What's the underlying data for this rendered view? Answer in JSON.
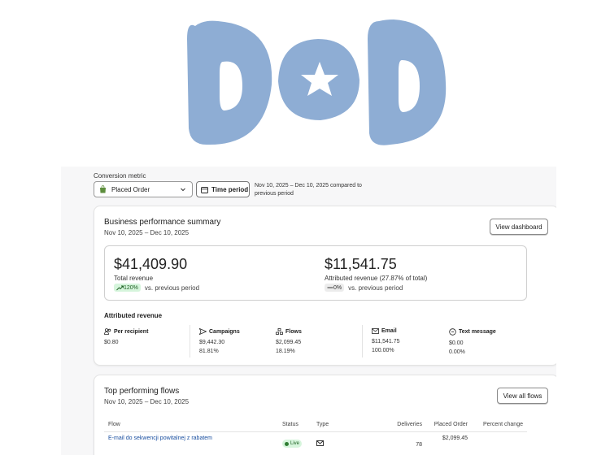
{
  "conversion": {
    "label": "Conversion metric",
    "selected": "Placed Order",
    "time_period_label": "Time period",
    "period_text": "Nov 10, 2025 – Dec 10, 2025 compared to previous period"
  },
  "summary": {
    "title": "Business performance summary",
    "date_range": "Nov 10, 2025 – Dec 10, 2025",
    "view_button": "View dashboard",
    "total_revenue": "$41,409.90",
    "total_label": "Total revenue",
    "total_delta": "120%",
    "total_delta_text": "vs. previous period",
    "attributed_revenue": "$11,541.75",
    "attributed_label": "Attributed revenue (27.87% of total)",
    "attributed_delta": "0%",
    "attributed_delta_text": "vs. previous period",
    "attributed_title": "Attributed revenue",
    "breakdown": [
      {
        "label": "Per recipient",
        "value": "$0.80",
        "pct": ""
      },
      {
        "label": "Campaigns",
        "value": "$9,442.30",
        "pct": "81.81%"
      },
      {
        "label": "Flows",
        "value": "$2,099.45",
        "pct": "18.19%"
      },
      {
        "label": "Email",
        "value": "$11,541.75",
        "pct": "100.00%"
      },
      {
        "label": "Text message",
        "value": "$0.00",
        "pct": "0.00%"
      }
    ]
  },
  "flows": {
    "title": "Top performing flows",
    "date_range": "Nov 10, 2025 – Dec 10, 2025",
    "view_button": "View all flows",
    "columns": [
      "Flow",
      "Status",
      "Type",
      "Deliveries",
      "Placed Order",
      "Percent change"
    ],
    "rows": [
      {
        "name": "E-mail do sekwencji powitalnej z rabatem",
        "status": "Live",
        "deliveries": "78",
        "placed_order": "$2,099.45",
        "change": ""
      }
    ]
  },
  "colors": {
    "logo_blue": "#8eadd4",
    "link": "#1a4fa0",
    "badge_green": "#d6f5dc"
  }
}
